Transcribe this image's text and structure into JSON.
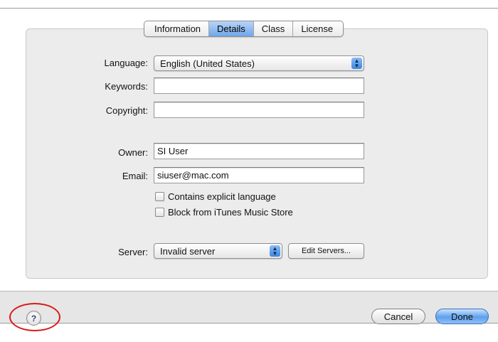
{
  "tabs": [
    {
      "label": "Information",
      "active": false
    },
    {
      "label": "Details",
      "active": true
    },
    {
      "label": "Class",
      "active": false
    },
    {
      "label": "License",
      "active": false
    }
  ],
  "form": {
    "language": {
      "label": "Language:",
      "value": "English (United States)"
    },
    "keywords": {
      "label": "Keywords:",
      "value": ""
    },
    "copyright": {
      "label": "Copyright:",
      "value": ""
    },
    "owner": {
      "label": "Owner:",
      "value": "SI User"
    },
    "email": {
      "label": "Email:",
      "value": "siuser@mac.com"
    },
    "explicit": {
      "label": "Contains explicit language",
      "checked": false
    },
    "block_store": {
      "label": "Block from iTunes Music Store",
      "checked": false
    },
    "server": {
      "label": "Server:",
      "value": "Invalid server"
    },
    "edit_servers_label": "Edit Servers..."
  },
  "footer": {
    "help_label": "?",
    "cancel_label": "Cancel",
    "done_label": "Done"
  },
  "colors": {
    "active_tab": "#6ea6ec",
    "default_button": "#5ea0ec",
    "highlight_ring": "#d81a1a"
  }
}
